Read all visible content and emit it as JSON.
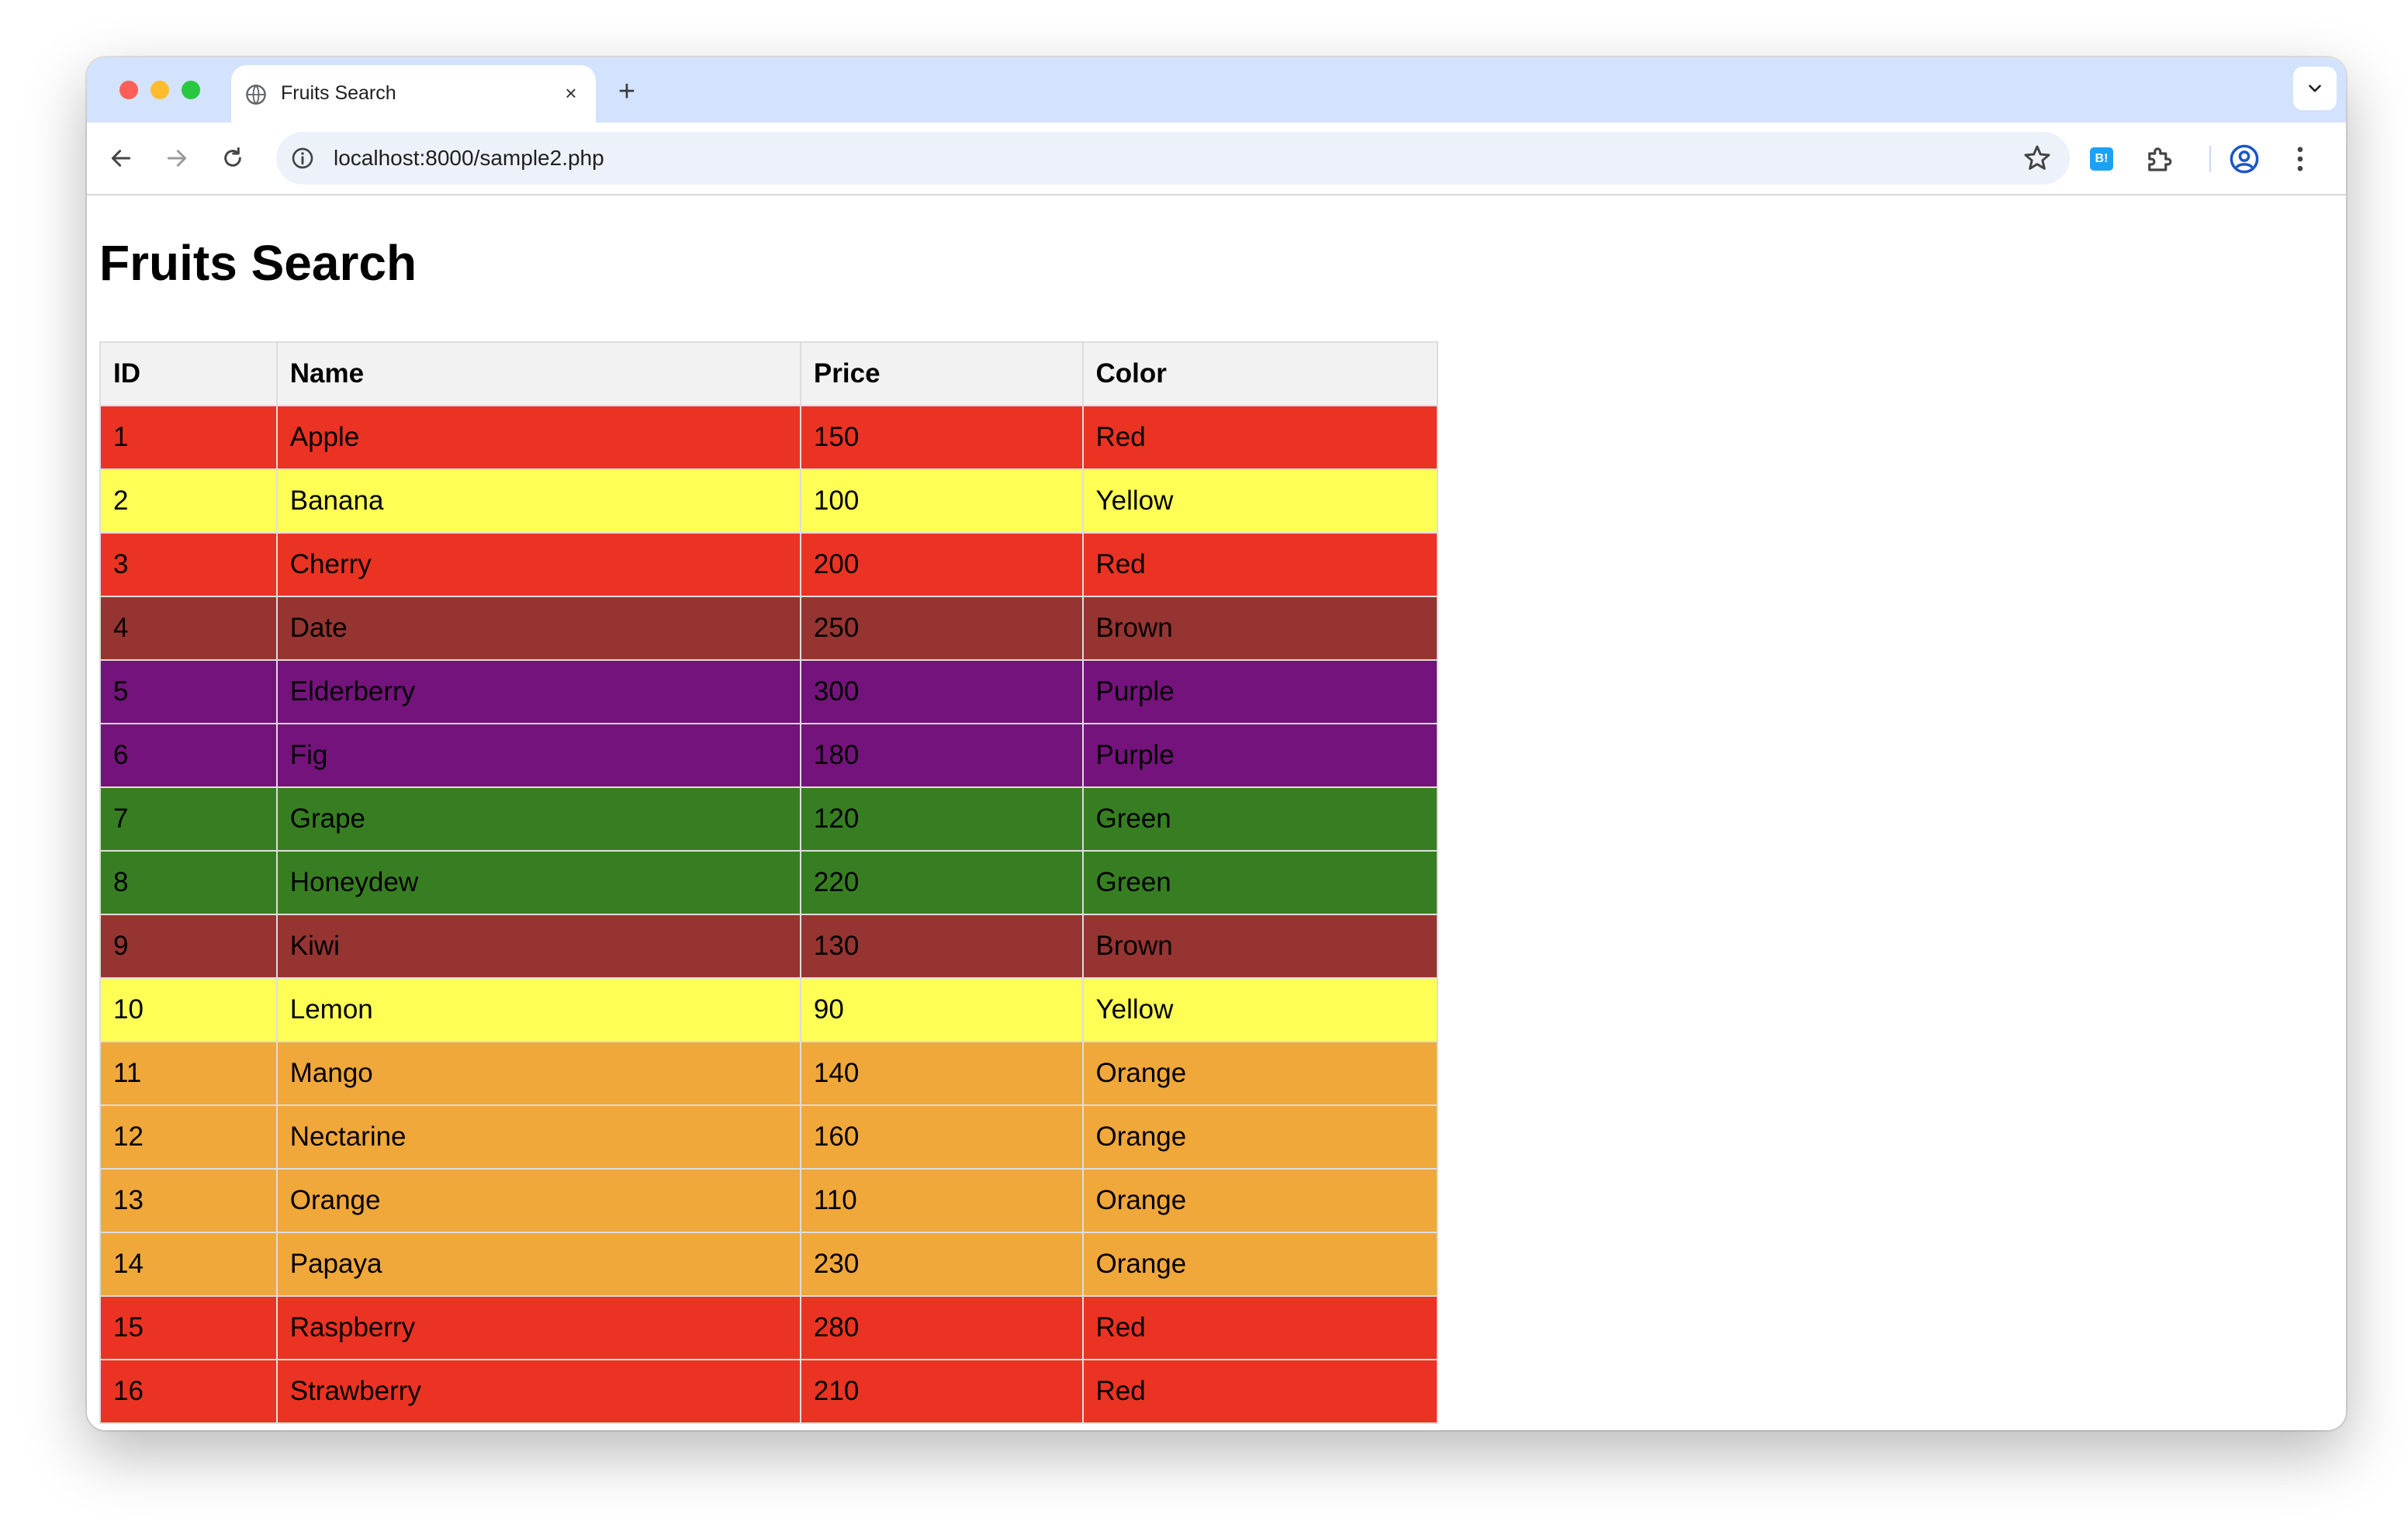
{
  "browser": {
    "tab_title": "Fruits Search",
    "url": "localhost:8000/sample2.php",
    "tab_close_glyph": "×",
    "new_tab_glyph": "+",
    "hatena_label": "B!"
  },
  "page": {
    "heading": "Fruits Search",
    "columns": [
      "ID",
      "Name",
      "Price",
      "Color"
    ],
    "color_map": {
      "Red": "#ea3323",
      "Yellow": "#fffe55",
      "Brown": "#953431",
      "Purple": "#74137b",
      "Green": "#377e22",
      "Orange": "#f0a83a"
    },
    "rows": [
      {
        "id": "1",
        "name": "Apple",
        "price": "150",
        "color": "Red"
      },
      {
        "id": "2",
        "name": "Banana",
        "price": "100",
        "color": "Yellow"
      },
      {
        "id": "3",
        "name": "Cherry",
        "price": "200",
        "color": "Red"
      },
      {
        "id": "4",
        "name": "Date",
        "price": "250",
        "color": "Brown"
      },
      {
        "id": "5",
        "name": "Elderberry",
        "price": "300",
        "color": "Purple"
      },
      {
        "id": "6",
        "name": "Fig",
        "price": "180",
        "color": "Purple"
      },
      {
        "id": "7",
        "name": "Grape",
        "price": "120",
        "color": "Green"
      },
      {
        "id": "8",
        "name": "Honeydew",
        "price": "220",
        "color": "Green"
      },
      {
        "id": "9",
        "name": "Kiwi",
        "price": "130",
        "color": "Brown"
      },
      {
        "id": "10",
        "name": "Lemon",
        "price": "90",
        "color": "Yellow"
      },
      {
        "id": "11",
        "name": "Mango",
        "price": "140",
        "color": "Orange"
      },
      {
        "id": "12",
        "name": "Nectarine",
        "price": "160",
        "color": "Orange"
      },
      {
        "id": "13",
        "name": "Orange",
        "price": "110",
        "color": "Orange"
      },
      {
        "id": "14",
        "name": "Papaya",
        "price": "230",
        "color": "Orange"
      },
      {
        "id": "15",
        "name": "Raspberry",
        "price": "280",
        "color": "Red"
      },
      {
        "id": "16",
        "name": "Strawberry",
        "price": "210",
        "color": "Red"
      }
    ]
  }
}
